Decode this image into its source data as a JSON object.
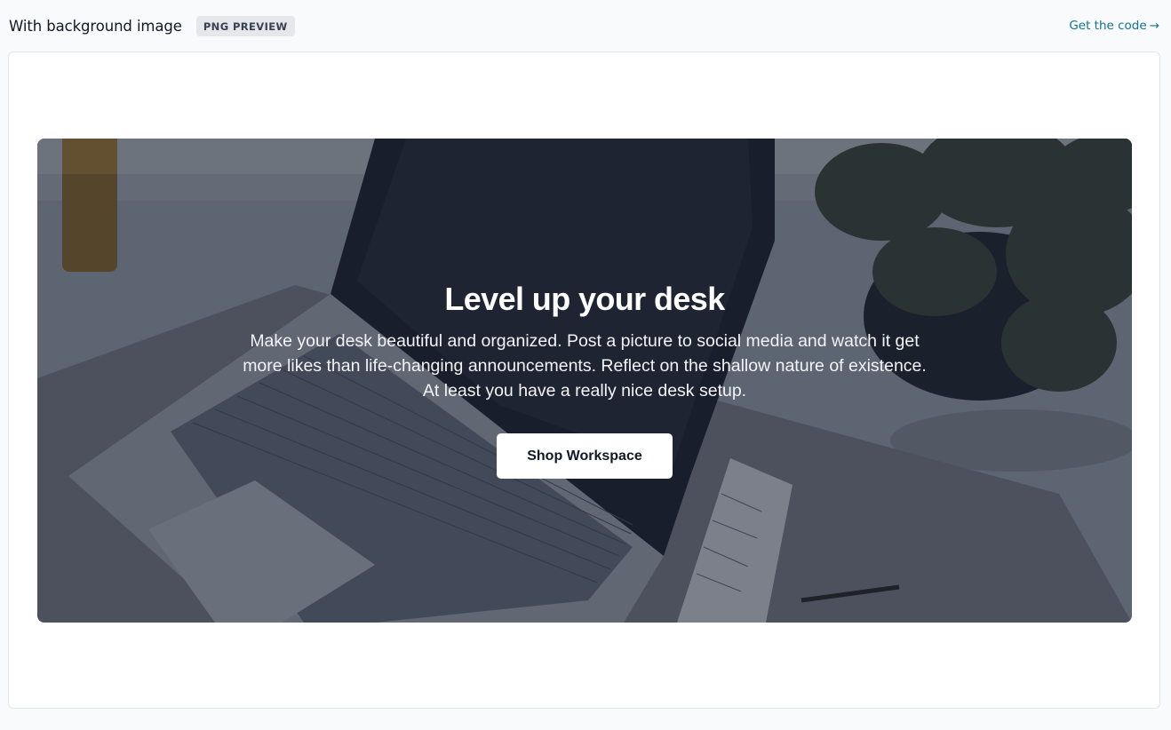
{
  "header": {
    "title": "With background image",
    "badge": "PNG PREVIEW",
    "link_label": "Get the code",
    "link_arrow": "→"
  },
  "hero": {
    "title": "Level up your desk",
    "description": "Make your desk beautiful and organized. Post a picture to social media and watch it get more likes than life-changing announcements. Reflect on the shallow nature of existence. At least you have a really nice desk setup.",
    "button_label": "Shop Workspace",
    "background_image": "laptop-on-desk-photo"
  },
  "colors": {
    "page_bg": "#f8fafc",
    "link": "#0e7490",
    "overlay": "#111827",
    "button_bg": "#ffffff"
  }
}
